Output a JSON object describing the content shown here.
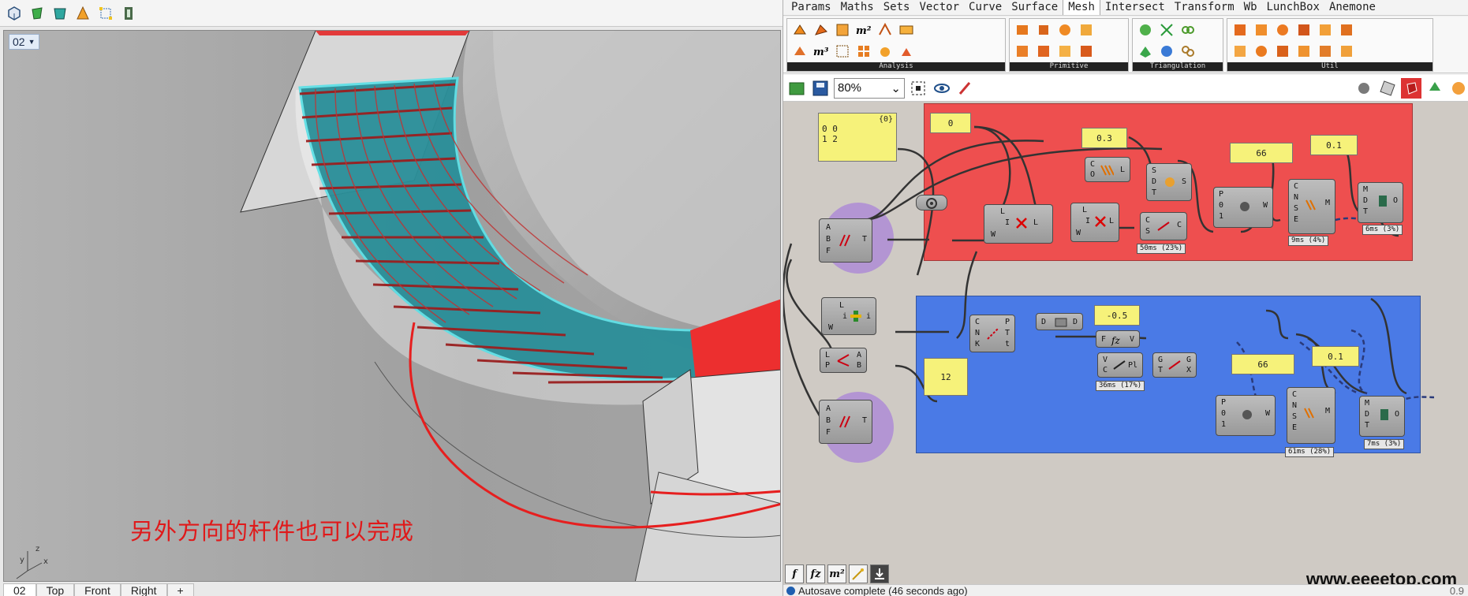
{
  "rhino": {
    "viewport_label": "02",
    "annotation": "另外方向的杆件也可以完成",
    "axis_labels": {
      "z": "z",
      "x": "x",
      "y": "y"
    },
    "tabs": [
      "02",
      "Top",
      "Front",
      "Right"
    ],
    "add_tab": "+"
  },
  "gh": {
    "menu_tabs": [
      "Params",
      "Maths",
      "Sets",
      "Vector",
      "Curve",
      "Surface",
      "Mesh",
      "Intersect",
      "Transform",
      "Wb",
      "LunchBox",
      "Anemone"
    ],
    "active_tab": "Mesh",
    "ribbon_panels": [
      "Analysis",
      "Primitive",
      "Triangulation",
      "Util"
    ],
    "zoom": "80%",
    "canvas": {
      "panel": {
        "header": "{0}",
        "rows": [
          "0 0",
          "1 2"
        ]
      },
      "sliders": {
        "s0": "0",
        "s03": "0.3",
        "s66a": "66",
        "s01a": "0.1",
        "sneg": "-0.5",
        "s12": "12",
        "s66b": "66",
        "s01b": "0.1"
      },
      "timers": [
        "50ms (23%)",
        "9ms (4%)",
        "6ms (3%)",
        "36ms (17%)",
        "61ms (28%)",
        "7ms (3%)"
      ]
    },
    "bottom_buttons": [
      "f",
      "fz",
      "m²",
      "sparkle",
      "download"
    ],
    "watermark": "www.eeeetop.com",
    "status": "Autosave complete (46 seconds ago)",
    "version": "0.9"
  },
  "colors": {
    "red_group": "#ee4f4f",
    "blue_group": "#4a7ae6",
    "slider": "#f6f27a",
    "annotation": "#e0191a",
    "mesh": "#2a8f99"
  }
}
